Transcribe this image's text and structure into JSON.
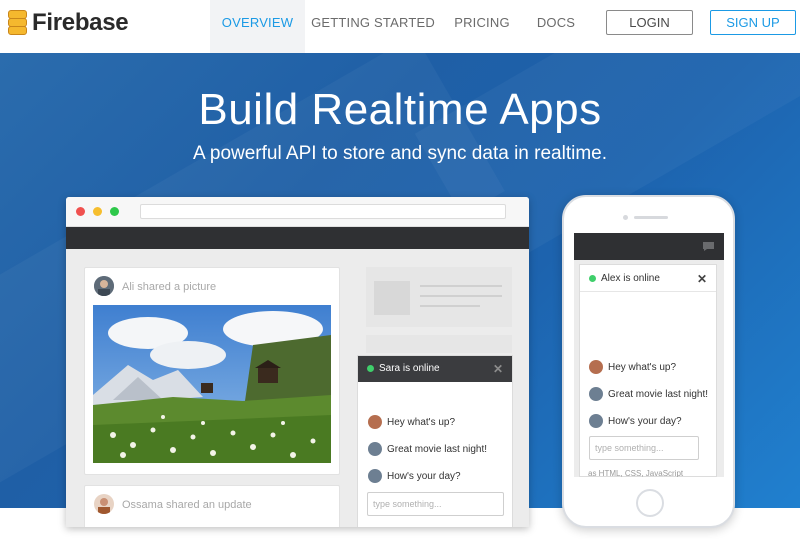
{
  "brand": {
    "name": "Firebase"
  },
  "nav": {
    "links": [
      {
        "label": "OVERVIEW",
        "active": true
      },
      {
        "label": "GETTING STARTED",
        "active": false
      },
      {
        "label": "PRICING",
        "active": false
      },
      {
        "label": "DOCS",
        "active": false
      }
    ],
    "login_label": "LOGIN",
    "signup_label": "SIGN UP"
  },
  "hero": {
    "title": "Build Realtime Apps",
    "subtitle": "A powerful API to store and sync data in realtime."
  },
  "browser_demo": {
    "post1": {
      "text": "Ali shared a picture"
    },
    "post2": {
      "text": "Ossama shared an update"
    },
    "chat": {
      "status": "Sara is online",
      "close": "✕",
      "messages": [
        "Hey what's up?",
        "Great movie last night!",
        "How's your day?"
      ],
      "input_placeholder": "type something..."
    }
  },
  "phone_demo": {
    "chat": {
      "status": "Alex is online",
      "close": "✕",
      "messages": [
        "Hey what's up?",
        "Great movie last night!",
        "How's your day?"
      ],
      "input_placeholder": "type something..."
    },
    "footer_text": "as HTML, CSS, JavaScript"
  },
  "colors": {
    "accent": "#1b9ae5",
    "hero_blue": "#1f5fa6",
    "online": "#3fcf6b",
    "dark_bar": "#2f3033",
    "window_red": "#f0514f",
    "window_yellow": "#f6be2e",
    "window_green": "#2ec84a"
  }
}
